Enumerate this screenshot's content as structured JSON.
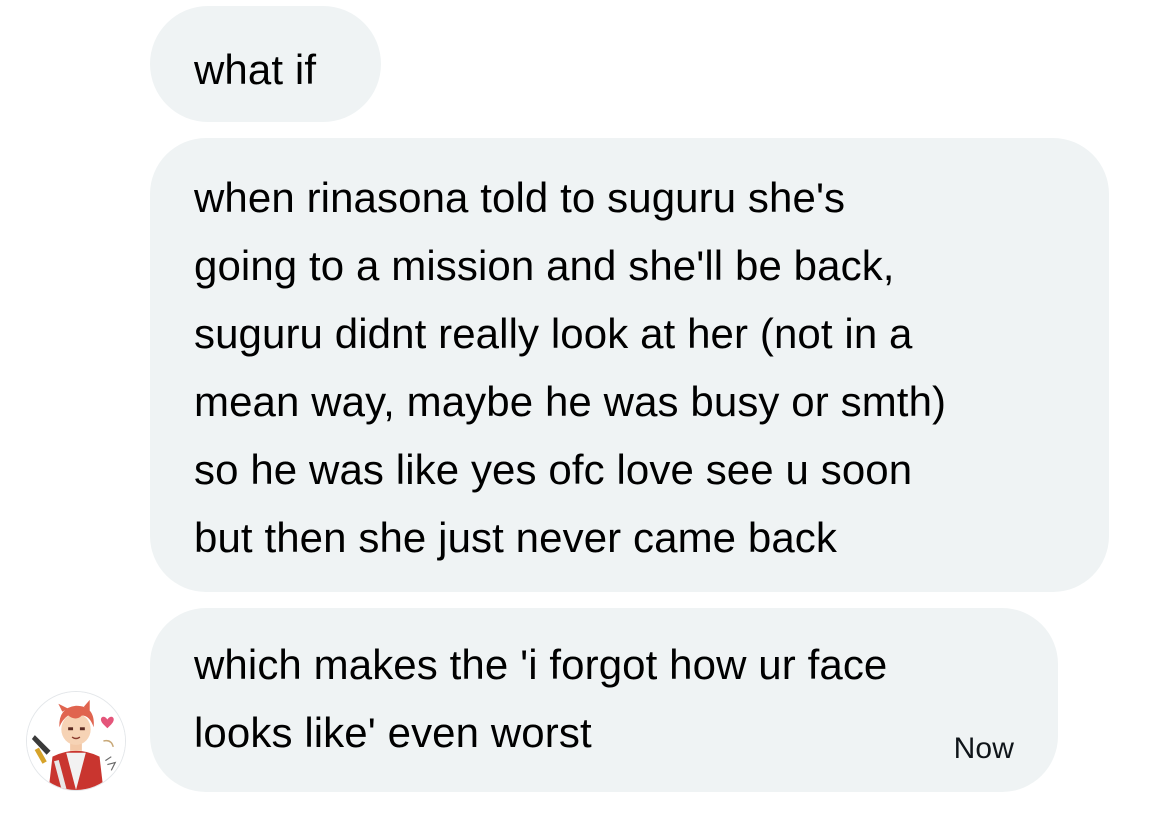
{
  "conversation": {
    "messages": [
      {
        "lines": [
          "what if"
        ]
      },
      {
        "lines": [
          "when rinasona told to suguru she's",
          "going to a mission and she'll be back,",
          "suguru didnt really look at her (not in a",
          "mean way, maybe he was busy or smth)",
          "so he was like yes ofc love see u soon",
          "but then she just never came back"
        ]
      },
      {
        "lines": [
          "which makes the 'i forgot how ur face",
          "looks like' even worst"
        ],
        "timestamp": "Now"
      }
    ]
  },
  "sender": {
    "avatar_icon": "anime-character-avatar-icon"
  },
  "colors": {
    "bubble_background": "#eff3f4",
    "text": "#000000",
    "page_background": "#ffffff"
  }
}
